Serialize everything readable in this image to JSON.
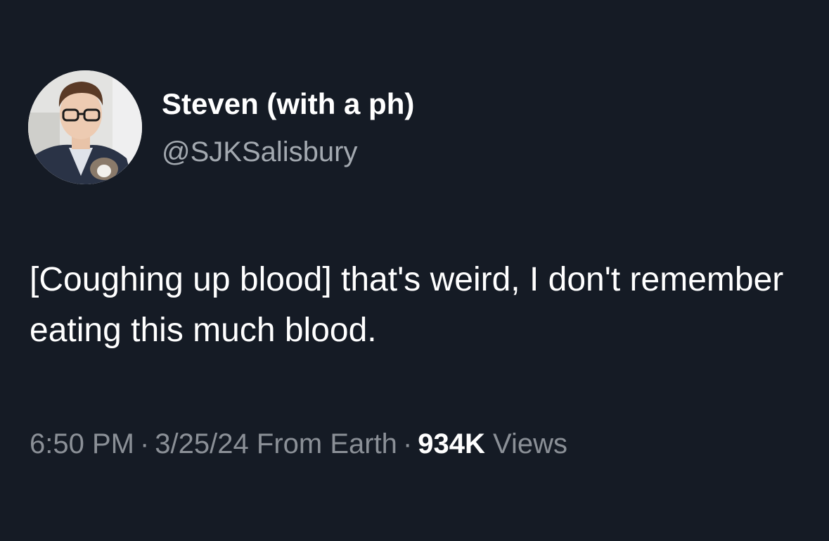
{
  "author": {
    "display_name": "Steven (with a ph)",
    "handle": "@SJKSalisbury",
    "avatar_icon": "profile-photo-avatar"
  },
  "tweet": {
    "text": "[Coughing up blood] that's weird, I don't remember eating this much blood."
  },
  "meta": {
    "time": "6:50 PM",
    "separator": "·",
    "date": "3/25/24",
    "source": "From Earth",
    "views_count": "934K",
    "views_label": "Views"
  },
  "colors": {
    "background": "#151b25",
    "primary_text": "#ffffff",
    "secondary_text": "#8b9097"
  }
}
